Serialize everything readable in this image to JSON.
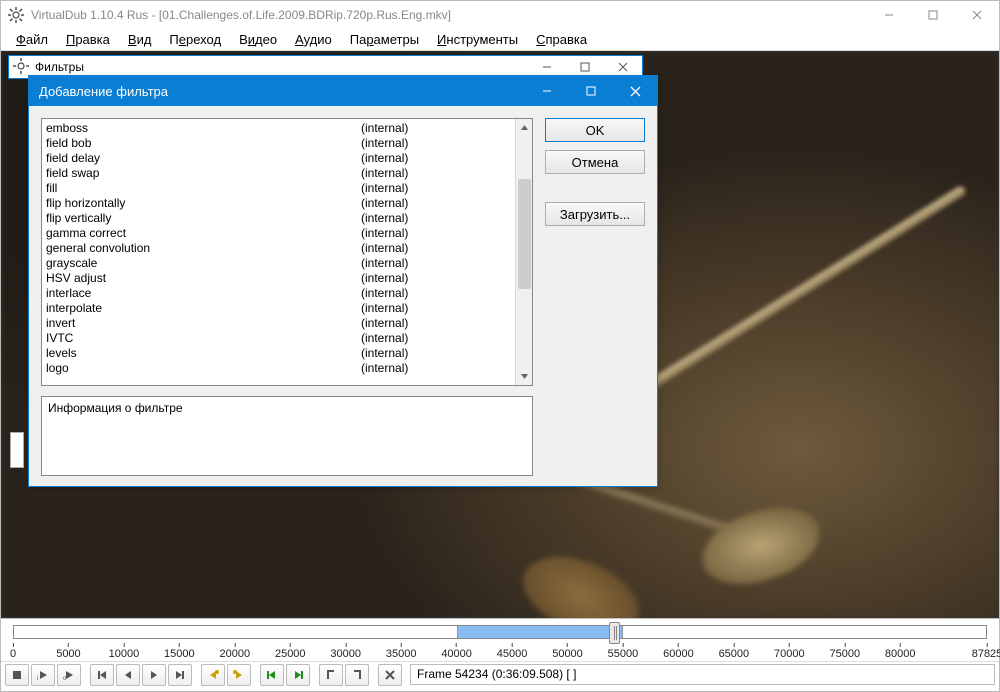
{
  "app": {
    "title": "VirtualDub 1.10.4 Rus - [01.Challenges.of.Life.2009.BDRip.720p.Rus.Eng.mkv]"
  },
  "menu": {
    "file": {
      "label": "Файл",
      "key": "Ф"
    },
    "edit": {
      "label": "Правка",
      "key": "П"
    },
    "view": {
      "label": "Вид",
      "key": "В"
    },
    "go": {
      "label": "Переход",
      "key": "е"
    },
    "video": {
      "label": "Видео",
      "key": "и"
    },
    "audio": {
      "label": "Аудио",
      "key": "А"
    },
    "options": {
      "label": "Параметры",
      "key": "р"
    },
    "tools": {
      "label": "Инструменты",
      "key": "И"
    },
    "help": {
      "label": "Справка",
      "key": "С"
    }
  },
  "filters_window": {
    "title": "Фильтры"
  },
  "add_filter": {
    "title": "Добавление фильтра",
    "info_label": "Информация о фильтре",
    "buttons": {
      "ok": "OK",
      "cancel": "Отмена",
      "load": "Загрузить..."
    },
    "source_internal": "(internal)",
    "filters": [
      "emboss",
      "field bob",
      "field delay",
      "field swap",
      "fill",
      "flip horizontally",
      "flip vertically",
      "gamma correct",
      "general convolution",
      "grayscale",
      "HSV adjust",
      "interlace",
      "interpolate",
      "invert",
      "IVTC",
      "levels",
      "logo"
    ]
  },
  "timeline": {
    "ticks": [
      "0",
      "5000",
      "10000",
      "15000",
      "20000",
      "25000",
      "30000",
      "35000",
      "40000",
      "45000",
      "50000",
      "55000",
      "60000",
      "65000",
      "70000",
      "75000",
      "80000",
      "87825"
    ],
    "max": 87825,
    "sel_start": 40000,
    "sel_end": 55000,
    "grip_frame": 54234
  },
  "status": {
    "frame_info": "Frame 54234 (0:36:09.508) [ ]"
  }
}
